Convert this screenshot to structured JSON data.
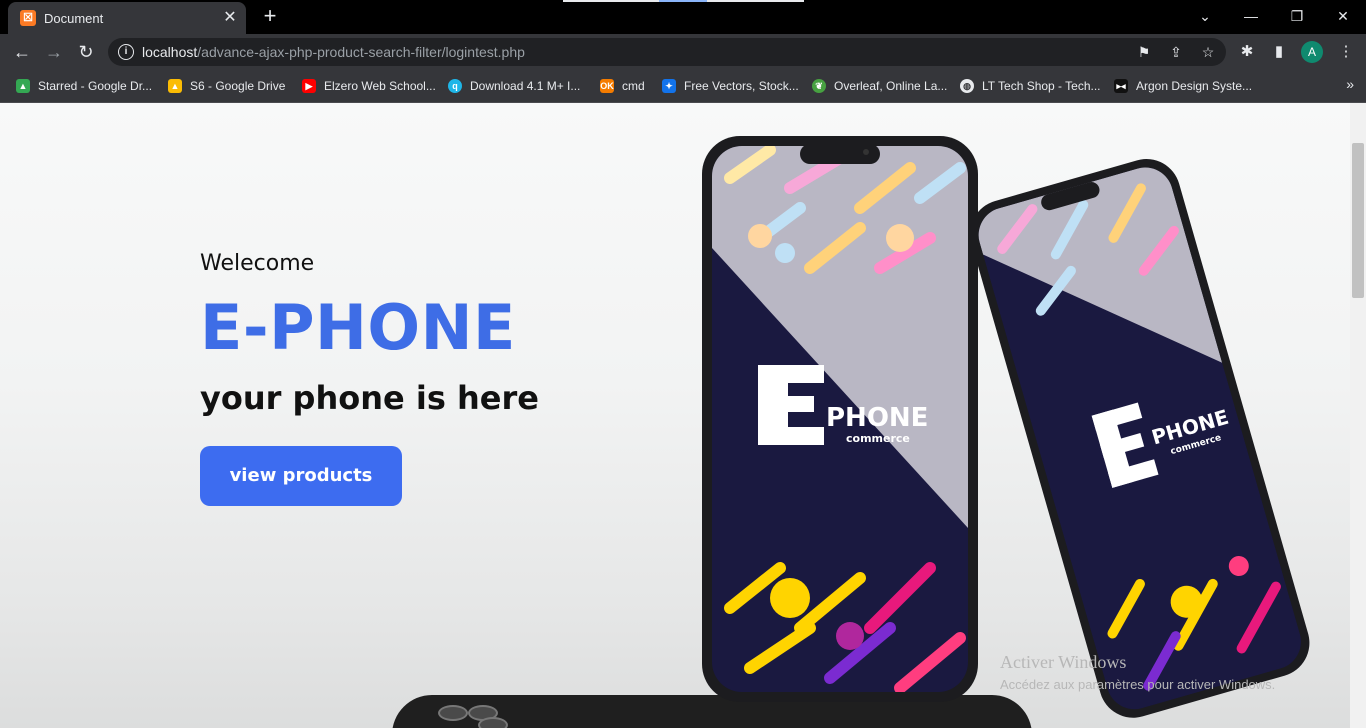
{
  "browser": {
    "tab": {
      "title": "Document",
      "favicon": "xampp-icon"
    },
    "address": {
      "host": "localhost",
      "path": "/advance-ajax-php-product-search-filter/logintest.php"
    },
    "profile_initial": "A",
    "bookmarks": [
      {
        "label": "Starred - Google Dr...",
        "icon": "google-drive-icon",
        "color": "#34a853"
      },
      {
        "label": "S6 - Google Drive",
        "icon": "google-drive-icon",
        "color": "#fbbc04"
      },
      {
        "label": "Elzero Web School...",
        "icon": "youtube-icon",
        "color": "#ff0000"
      },
      {
        "label": "Download 4.1 M+ I...",
        "icon": "search-bubble-icon",
        "color": "#1fb6e8"
      },
      {
        "label": "cmd",
        "icon": "ok-icon",
        "color": "#f57c00"
      },
      {
        "label": "Free Vectors, Stock...",
        "icon": "freepik-icon",
        "color": "#1273eb"
      },
      {
        "label": "Overleaf, Online La...",
        "icon": "overleaf-icon",
        "color": "#47a141"
      },
      {
        "label": "LT Tech Shop - Tech...",
        "icon": "globe-icon",
        "color": "#e8eaed"
      },
      {
        "label": "Argon Design Syste...",
        "icon": "argon-icon",
        "color": "#111111"
      }
    ]
  },
  "hero": {
    "greeting": "Welecome",
    "brand": "E-PHONE",
    "tagline": "your phone is here",
    "cta_label": "view products",
    "accent_color": "#3e6de6"
  },
  "phones": {
    "logo_letter": "E",
    "logo_word": "PHONE",
    "logo_sub": "commerce"
  },
  "watermark": {
    "title": "Activer Windows",
    "subtitle": "Accédez aux paramètres pour activer Windows."
  }
}
